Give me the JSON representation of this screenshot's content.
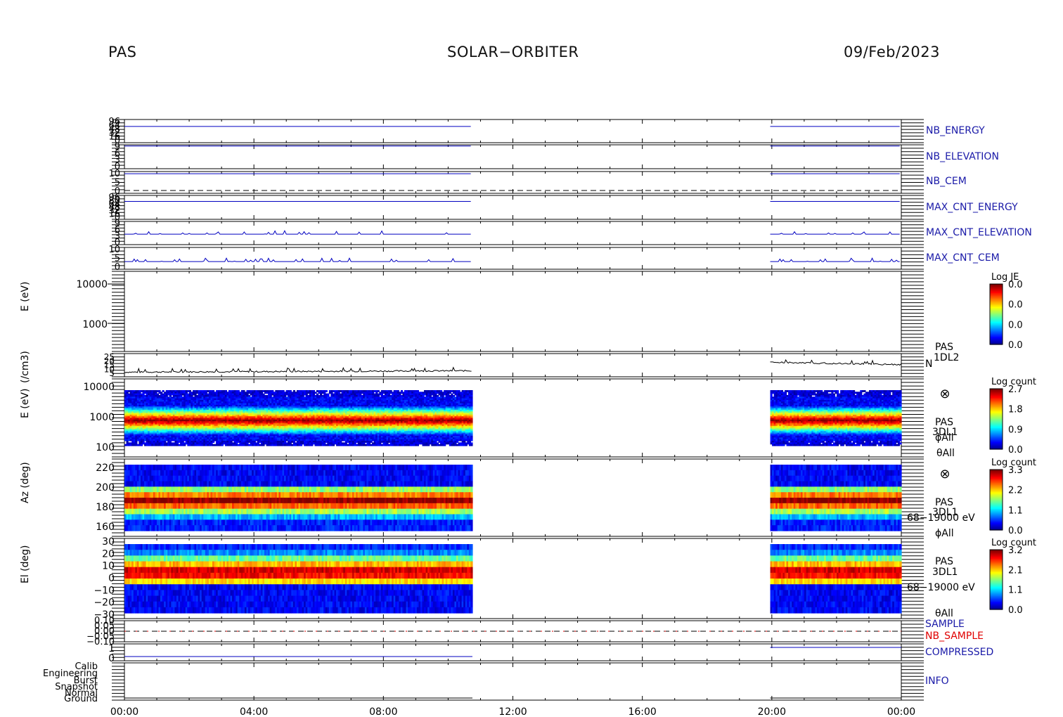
{
  "header": {
    "instrument": "PAS",
    "mission": "SOLAR−ORBITER",
    "date": "09/Feb/2023"
  },
  "colors": {
    "ink": "#000000",
    "trace_blue": "#0000c0",
    "label_blue": "#1a1aa8",
    "nb_sample_red": "#e00000"
  },
  "chart_data": [
    {
      "type": "line",
      "panel": "status",
      "right_label": "NB_ENERGY",
      "yticks": [
        "96",
        "64",
        "48",
        "32",
        "16",
        "0"
      ],
      "series": [
        {
          "name": "NB_ENERGY",
          "segments": [
            [
              0.0,
              10.75
            ],
            [
              19.95,
              24.0
            ]
          ],
          "level": 0.7
        }
      ]
    },
    {
      "type": "line",
      "panel": "status",
      "right_label": "NB_ELEVATION",
      "yticks": [
        "9",
        "6",
        "3",
        "0"
      ],
      "series": [
        {
          "name": "NB_ELEVATION",
          "segments": [
            [
              0.0,
              10.75
            ],
            [
              19.95,
              24.0
            ]
          ],
          "level": 0.95
        }
      ]
    },
    {
      "type": "line",
      "panel": "status",
      "right_label": "NB_CEM",
      "yticks": [
        "10",
        "5",
        "0"
      ],
      "series": [
        {
          "name": "NB_CEM",
          "segments": [
            [
              0.0,
              10.75
            ],
            [
              19.95,
              24.0
            ]
          ],
          "level": 0.9
        }
      ]
    },
    {
      "type": "line",
      "panel": "status",
      "right_label": "MAX_CNT_ENERGY",
      "yticks": [
        "96",
        "80",
        "64",
        "48",
        "32",
        "16",
        "0"
      ],
      "series": [
        {
          "name": "MAX_CNT_ENERGY",
          "segments": [
            [
              0.0,
              10.75
            ],
            [
              19.95,
              24.0
            ]
          ],
          "level": 0.75
        }
      ]
    },
    {
      "type": "line",
      "panel": "status",
      "right_label": "MAX_CNT_ELEVATION",
      "yticks": [
        "9",
        "6",
        "3",
        "0"
      ],
      "series": [
        {
          "name": "MAX_CNT_ELEVATION",
          "segments": [
            [
              0.0,
              10.75
            ],
            [
              19.95,
              24.0
            ]
          ],
          "level": 0.45
        }
      ]
    },
    {
      "type": "line",
      "panel": "status",
      "right_label": "MAX_CNT_CEM",
      "yticks": [
        "10",
        "5",
        "0"
      ],
      "series": [
        {
          "name": "MAX_CNT_CEM",
          "segments": [
            [
              0.0,
              10.75
            ],
            [
              19.95,
              24.0
            ]
          ],
          "level": 0.35
        }
      ]
    },
    {
      "type": "heatmap",
      "panel": "energy-1d",
      "ylabel": "E (eV)",
      "ytick_labels": [
        "10000",
        "1000"
      ],
      "ylim": [
        80,
        25000
      ],
      "colorbar": {
        "label": "Log JE",
        "ticks": [
          "0.0",
          "0.0",
          "0.0",
          "0.0"
        ]
      },
      "values": []
    },
    {
      "type": "line",
      "panel": "density",
      "ylabel": "(/cm3)",
      "ytick_labels": [
        "25",
        "20",
        "15",
        "10",
        "5"
      ],
      "ylim": [
        5,
        25
      ],
      "right_labels": [
        "PAS",
        "1DL2",
        "N"
      ],
      "series": [
        {
          "name": "N",
          "segments": [
            {
              "t": [
                0.0,
                10.75
              ],
              "y": [
                9.0,
                10.2
              ]
            },
            {
              "t": [
                19.95,
                24.0
              ],
              "y": [
                17.5,
                15.5
              ]
            }
          ]
        }
      ]
    },
    {
      "type": "heatmap",
      "panel": "energy-3d",
      "ylabel": "E (eV)",
      "ytick_labels": [
        "10000",
        "1000",
        "100"
      ],
      "ylim": [
        100,
        10000
      ],
      "colorbar": {
        "label": "Log count",
        "ticks": [
          "2.7",
          "1.8",
          "0.9",
          "0.0"
        ]
      },
      "right_labels": [
        "PAS",
        "3DL1",
        "ϕAll",
        "θAll"
      ],
      "coverage": [
        [
          0.0,
          10.75
        ],
        [
          19.95,
          24.0
        ]
      ],
      "peak_energy_eV": 700
    },
    {
      "type": "heatmap",
      "panel": "azimuth",
      "ylabel": "Az (deg)",
      "ytick_labels": [
        "220",
        "200",
        "180",
        "160"
      ],
      "ylim": [
        150,
        225
      ],
      "colorbar": {
        "label": "Log count",
        "ticks": [
          "3.3",
          "2.2",
          "1.1",
          "0.0"
        ]
      },
      "right_labels": [
        "PAS",
        "3DL1",
        "68−19000 eV",
        "ϕAll"
      ],
      "coverage": [
        [
          0.0,
          10.75
        ],
        [
          19.95,
          24.0
        ]
      ],
      "peak_az_deg": 182
    },
    {
      "type": "heatmap",
      "panel": "elevation",
      "ylabel": "El (deg)",
      "ytick_labels": [
        "30",
        "20",
        "10",
        "0",
        "−10",
        "−20",
        "−30"
      ],
      "ylim": [
        -30,
        30
      ],
      "colorbar": {
        "label": "Log count",
        "ticks": [
          "3.2",
          "2.1",
          "1.1",
          "0.0"
        ]
      },
      "right_labels": [
        "PAS",
        "3DL1",
        "68−19000 eV",
        "θAll"
      ],
      "coverage": [
        [
          0.0,
          10.75
        ],
        [
          19.95,
          24.0
        ]
      ],
      "peak_el_deg": 0
    },
    {
      "type": "line",
      "panel": "sample",
      "ytick_labels": [
        "0.10",
        "0.05",
        "0.00",
        "−0.05",
        "−0.10"
      ],
      "right_labels": [
        "SAMPLE",
        "NB_SAMPLE"
      ],
      "series": [
        {
          "name": "NB_SAMPLE",
          "segments": [
            [
              0.0,
              24.0
            ]
          ],
          "y": 0.0
        }
      ]
    },
    {
      "type": "line",
      "panel": "compressed",
      "ytick_labels": [
        "1",
        "0"
      ],
      "right_labels": [
        "COMPRESSED"
      ],
      "series": [
        {
          "name": "COMPRESSED",
          "segments": [
            {
              "t": [
                0.0,
                10.75
              ],
              "y": 0
            },
            {
              "t": [
                19.95,
                24.0
              ],
              "y": 1
            }
          ]
        }
      ]
    },
    {
      "type": "line",
      "panel": "info",
      "ytick_labels": [
        "Calib",
        "Engineering",
        "Burst",
        "Snapshot",
        "Normal",
        "Ground"
      ],
      "right_labels": [
        "INFO"
      ],
      "series": [
        {
          "name": "INFO",
          "segments": [
            [
              0.0,
              10.75
            ],
            [
              19.95,
              24.0
            ]
          ],
          "y": "Ground"
        }
      ]
    }
  ],
  "xaxis": {
    "tick_labels": [
      "00:00",
      "04:00",
      "08:00",
      "12:00",
      "16:00",
      "20:00",
      "00:00"
    ],
    "range_hours": [
      0,
      24
    ]
  }
}
